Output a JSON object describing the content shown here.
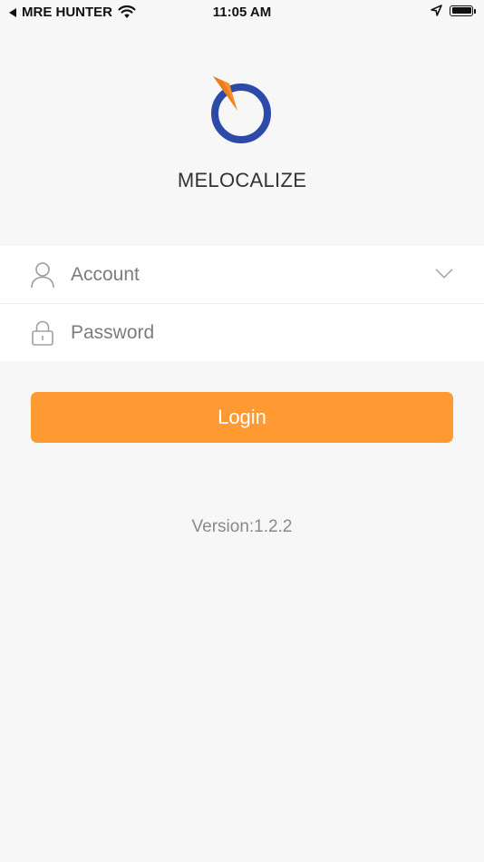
{
  "status_bar": {
    "carrier": "MRE HUNTER",
    "time": "11:05 AM"
  },
  "branding": {
    "app_name": "MELOCALIZE",
    "colors": {
      "ring": "#2e4aa8",
      "pin": "#f7912a"
    }
  },
  "login_form": {
    "account_placeholder": "Account",
    "account_value": "",
    "password_placeholder": "Password",
    "password_value": "",
    "login_label": "Login"
  },
  "footer": {
    "version": "Version:1.2.2"
  },
  "colors": {
    "accent": "#ff9a33",
    "background": "#f7f7f7"
  }
}
